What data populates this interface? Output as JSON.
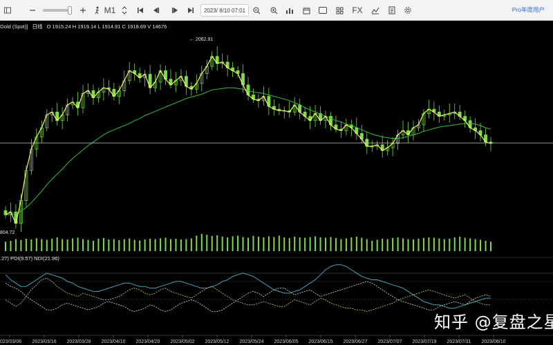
{
  "toolbar": {
    "zoom_minus_icon": "minus-icon",
    "zoom_plus_icon": "plus-icon",
    "period_label": "M1",
    "date_value": "2023/ 8/10 07:01",
    "fx_label": "FX",
    "pro_label": "Pro年度用户"
  },
  "info": {
    "symbol": "Gold (Spot)]",
    "timeframe": "日线",
    "ohlcv": "O 1915.24 H 1919.14 L 1914.91 C 1918.69 V 14676"
  },
  "annotations": {
    "high_label": "← 2062.91",
    "low_label": "804.72"
  },
  "indicator": {
    "label": ".27) PDI(9.57) NDI(21.96)"
  },
  "x_axis": {
    "ticks": [
      "023/03/06",
      "2023/03/16",
      "2023/03/28",
      "2023/04/10",
      "2023/04/20",
      "2023/05/02",
      "2023/05/12",
      "2023/05/24",
      "2023/06/05",
      "2023/06/15",
      "2023/06/27",
      "2023/07/07",
      "2023/07/19",
      "2023/07/31",
      "2023/08/10"
    ]
  },
  "colors": {
    "up": "#7ddc4a",
    "close_line": "#f4f46a",
    "ma_line": "#34c23a",
    "adx": "#4aa3b8",
    "pdi": "#e0d27a",
    "ndi": "#e8e8e8"
  },
  "watermark": "知乎 @复盘之星",
  "chart_data": {
    "type": "line",
    "title": "",
    "price_line_level": 1918.69,
    "high": 2062.91,
    "low": 1804.72,
    "close": [
      1818,
      1822,
      1806,
      1838,
      1880,
      1910,
      1927,
      1940,
      1958,
      1962,
      1950,
      1958,
      1972,
      1976,
      1968,
      1988,
      1992,
      1982,
      1990,
      1996,
      1994,
      1984,
      1992,
      2006,
      2020,
      2016,
      2010,
      2015,
      1996,
      2004,
      2020,
      2008,
      2000,
      2006,
      2012,
      1998,
      1994,
      2002,
      2016,
      2026,
      2040,
      2030,
      2032,
      2024,
      2020,
      2016,
      2000,
      1986,
      1980,
      1978,
      1984,
      1970,
      1966,
      1964,
      1964,
      1962,
      1972,
      1962,
      1956,
      1950,
      1960,
      1950,
      1956,
      1944,
      1938,
      1936,
      1944,
      1940,
      1932,
      1924,
      1914,
      1914,
      1916,
      1908,
      1912,
      1918,
      1930,
      1936,
      1930,
      1940,
      1944,
      1960,
      1966,
      1962,
      1956,
      1958,
      1960,
      1962,
      1956,
      1950,
      1940,
      1936,
      1930,
      1920,
      1918
    ],
    "ma": [
      1818,
      1818,
      1820,
      1823,
      1828,
      1835,
      1843,
      1851,
      1860,
      1868,
      1875,
      1882,
      1890,
      1897,
      1903,
      1909,
      1915,
      1920,
      1925,
      1930,
      1934,
      1937,
      1940,
      1943,
      1946,
      1950,
      1953,
      1957,
      1960,
      1963,
      1966,
      1969,
      1972,
      1975,
      1978,
      1981,
      1983,
      1985,
      1987,
      1990,
      1993,
      1994,
      1995,
      1996,
      1996,
      1995,
      1994,
      1992,
      1990,
      1989,
      1988,
      1986,
      1984,
      1982,
      1980,
      1978,
      1975,
      1972,
      1968,
      1965,
      1962,
      1959,
      1956,
      1953,
      1950,
      1948,
      1945,
      1943,
      1940,
      1937,
      1934,
      1931,
      1929,
      1927,
      1926,
      1925,
      1925,
      1926,
      1928,
      1930,
      1932,
      1935,
      1937,
      1939,
      1941,
      1942,
      1943,
      1944,
      1945,
      1946,
      1946,
      1945,
      1943,
      1940,
      1938
    ],
    "volume": [
      0.55,
      0.6,
      0.7,
      0.65,
      0.72,
      0.68,
      0.75,
      0.7,
      0.66,
      0.72,
      0.8,
      0.7,
      0.68,
      0.74,
      0.78,
      0.7,
      0.66,
      0.6,
      0.72,
      0.76,
      0.68,
      0.7,
      0.64,
      0.7,
      0.74,
      0.66,
      0.62,
      0.68,
      0.72,
      0.7,
      0.74,
      0.78,
      0.7,
      0.72,
      0.68,
      0.7,
      0.74,
      0.9,
      1.0,
      0.95,
      0.88,
      0.92,
      0.85,
      0.8,
      0.86,
      0.9,
      0.82,
      0.78,
      0.88,
      0.84,
      0.8,
      0.86,
      0.82,
      0.9,
      0.8,
      0.76,
      0.84,
      0.8,
      0.78,
      0.82,
      0.86,
      0.8,
      0.78,
      0.82,
      0.76,
      0.7,
      0.74,
      0.8,
      0.84,
      0.78,
      0.7,
      0.6,
      0.66,
      0.72,
      0.7,
      0.76,
      0.8,
      0.74,
      0.7,
      0.68,
      0.72,
      0.76,
      0.8,
      0.78,
      0.74,
      0.7,
      0.72,
      0.8,
      0.84,
      0.78,
      0.74,
      0.7,
      0.66,
      0.6,
      0.55
    ],
    "adx": [
      35,
      32,
      30,
      28,
      28,
      30,
      32,
      34,
      36,
      35,
      34,
      33,
      31,
      30,
      28,
      27,
      26,
      25,
      25,
      26,
      27,
      28,
      29,
      30,
      30,
      29,
      28,
      28,
      27,
      27,
      28,
      29,
      30,
      31,
      31,
      30,
      29,
      28,
      27,
      27,
      28,
      29,
      31,
      32,
      34,
      35,
      36,
      35,
      34,
      32,
      30,
      28,
      26,
      25,
      24,
      24,
      25,
      26,
      28,
      30,
      32,
      35,
      38,
      40,
      41,
      41,
      40,
      38,
      36,
      34,
      33,
      32,
      32,
      31,
      30,
      29,
      28,
      27,
      25,
      23,
      21,
      19,
      18,
      17,
      17,
      16,
      15,
      15,
      16,
      17,
      18,
      19,
      20,
      21,
      21
    ],
    "pdi": [
      20,
      18,
      16,
      18,
      22,
      26,
      29,
      32,
      33,
      31,
      28,
      26,
      24,
      23,
      22,
      24,
      23,
      22,
      21,
      20,
      20,
      21,
      22,
      24,
      26,
      27,
      26,
      24,
      23,
      24,
      26,
      27,
      25,
      24,
      23,
      22,
      21,
      23,
      25,
      27,
      28,
      26,
      24,
      22,
      20,
      19,
      18,
      17,
      17,
      18,
      19,
      18,
      17,
      16,
      16,
      18,
      20,
      19,
      18,
      17,
      19,
      21,
      20,
      18,
      17,
      16,
      15,
      15,
      14,
      14,
      13,
      14,
      15,
      16,
      17,
      18,
      20,
      21,
      22,
      23,
      24,
      25,
      26,
      25,
      24,
      23,
      22,
      21,
      22,
      23,
      21,
      19,
      18,
      17,
      17
    ],
    "ndi": [
      30,
      28,
      27,
      25,
      22,
      20,
      18,
      16,
      14,
      14,
      15,
      17,
      18,
      17,
      16,
      15,
      14,
      15,
      16,
      18,
      19,
      18,
      17,
      16,
      14,
      13,
      14,
      15,
      17,
      16,
      14,
      13,
      14,
      16,
      18,
      19,
      20,
      19,
      17,
      15,
      13,
      13,
      14,
      16,
      18,
      20,
      22,
      24,
      25,
      24,
      22,
      24,
      26,
      27,
      27,
      25,
      23,
      24,
      25,
      26,
      24,
      22,
      23,
      24,
      25,
      26,
      27,
      28,
      29,
      30,
      31,
      30,
      28,
      26,
      24,
      22,
      20,
      19,
      18,
      17,
      16,
      15,
      14,
      14,
      16,
      17,
      18,
      19,
      18,
      17,
      19,
      21,
      22,
      23,
      22
    ]
  }
}
